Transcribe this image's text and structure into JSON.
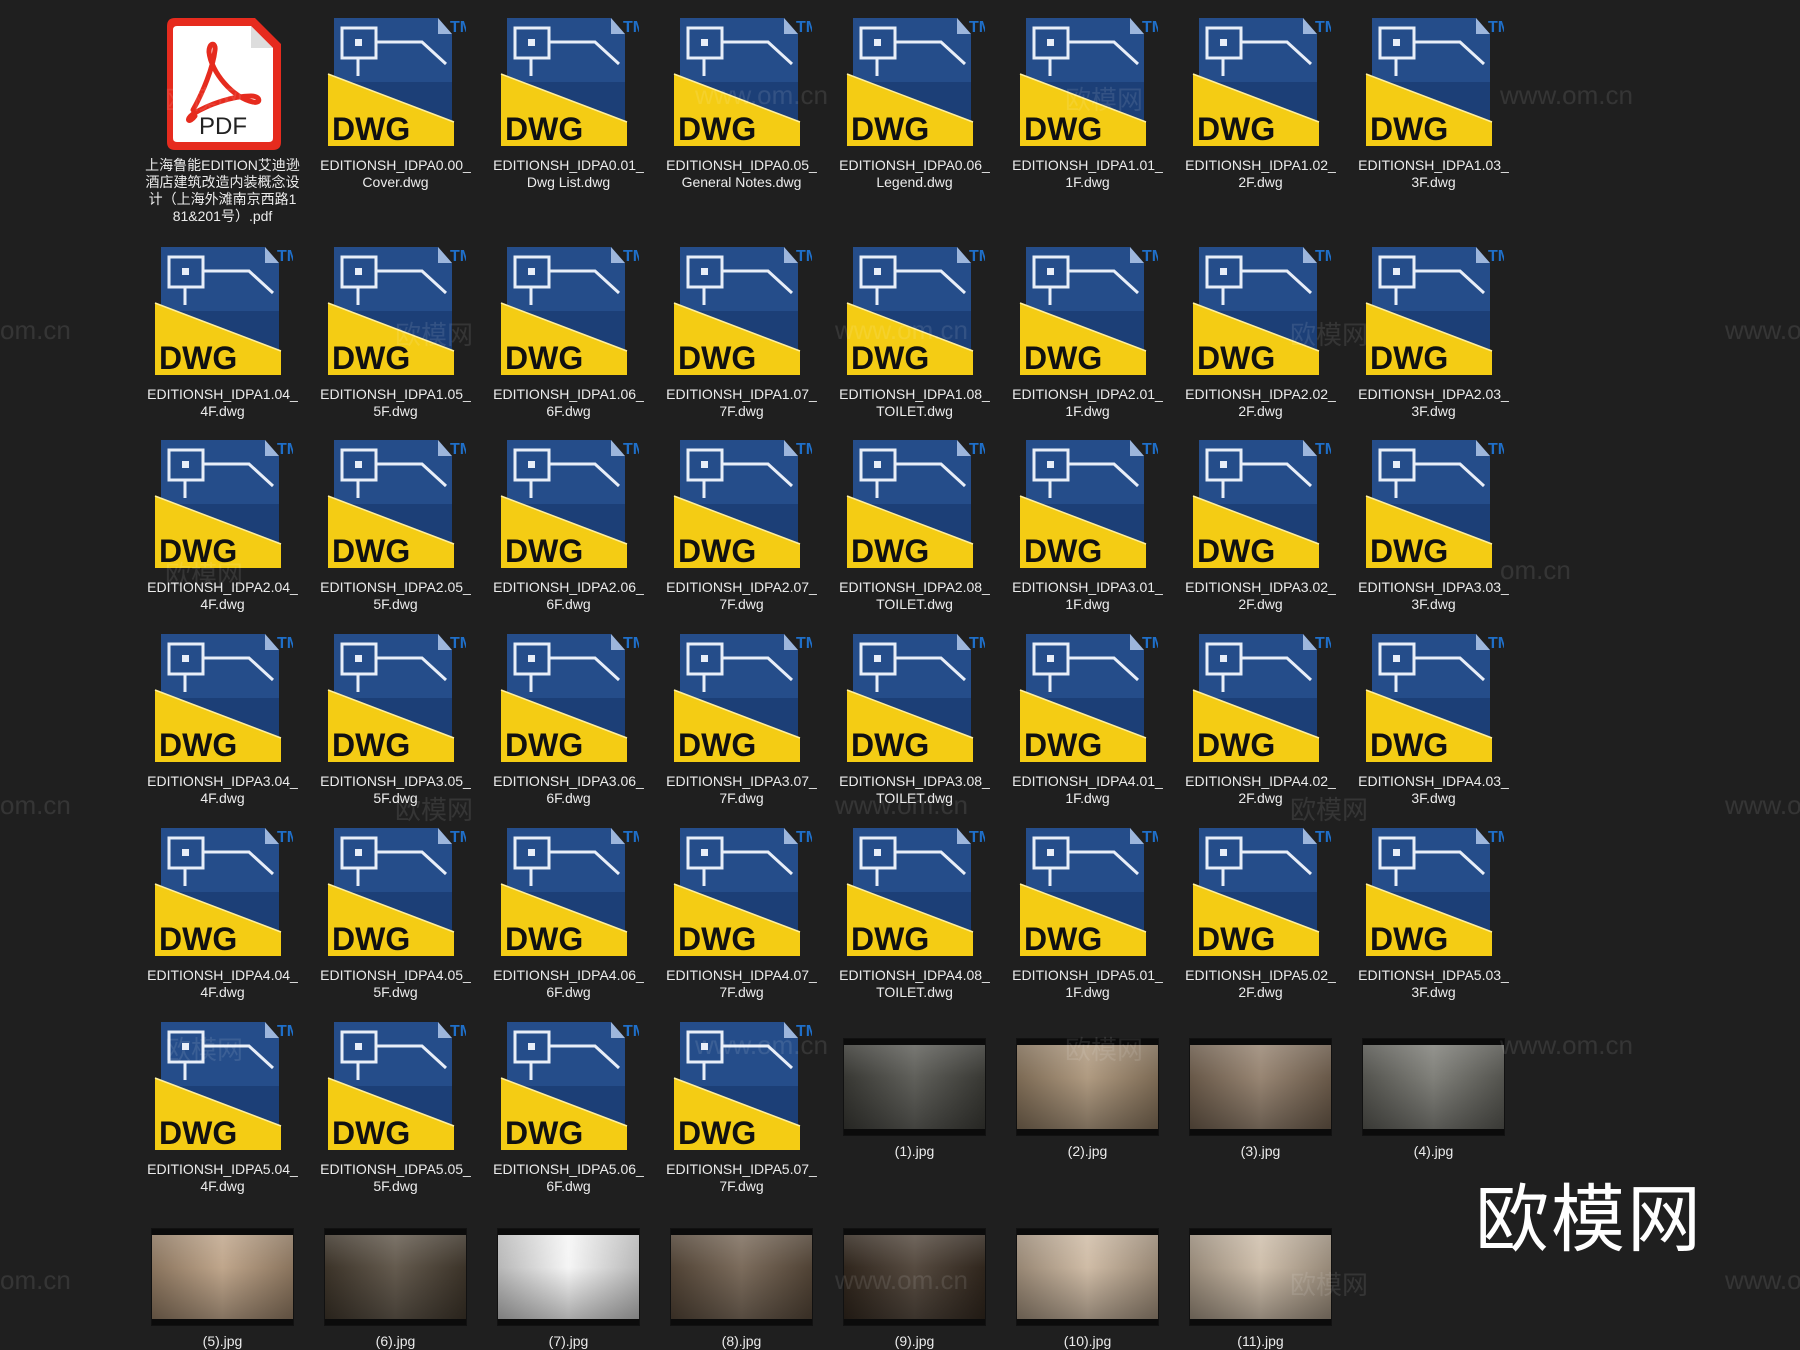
{
  "colors": {
    "background": "#1f1f1f",
    "dwg_yellow": "#f4cc14",
    "dwg_blue": "#1c3f77",
    "pdf_red": "#e62b1e",
    "tm_blue": "#1f6fc9",
    "label_text": "#ececec"
  },
  "watermarks": [
    "欧模网",
    "www.om.cn",
    "om.cn",
    "www.om.cn"
  ],
  "brand_watermark": "欧模网",
  "files": [
    {
      "type": "pdf",
      "icon": "pdf-file-icon",
      "badge": "PDF",
      "name": "上海鲁能EDITION艾迪逊酒店建筑改造内装概念设计（上海外滩南京西路181&201号）.pdf"
    },
    {
      "type": "dwg",
      "icon": "dwg-file-icon",
      "badge": "DWG",
      "tm": "TM",
      "name": "EDITIONSH_IDPA0.00_Cover.dwg"
    },
    {
      "type": "dwg",
      "icon": "dwg-file-icon",
      "badge": "DWG",
      "tm": "TM",
      "name": "EDITIONSH_IDPA0.01_Dwg List.dwg"
    },
    {
      "type": "dwg",
      "icon": "dwg-file-icon",
      "badge": "DWG",
      "tm": "TM",
      "name": "EDITIONSH_IDPA0.05_General Notes.dwg"
    },
    {
      "type": "dwg",
      "icon": "dwg-file-icon",
      "badge": "DWG",
      "tm": "TM",
      "name": "EDITIONSH_IDPA0.06_Legend.dwg"
    },
    {
      "type": "dwg",
      "icon": "dwg-file-icon",
      "badge": "DWG",
      "tm": "TM",
      "name": "EDITIONSH_IDPA1.01_1F.dwg"
    },
    {
      "type": "dwg",
      "icon": "dwg-file-icon",
      "badge": "DWG",
      "tm": "TM",
      "name": "EDITIONSH_IDPA1.02_2F.dwg"
    },
    {
      "type": "dwg",
      "icon": "dwg-file-icon",
      "badge": "DWG",
      "tm": "TM",
      "name": "EDITIONSH_IDPA1.03_3F.dwg"
    },
    {
      "type": "dwg",
      "icon": "dwg-file-icon",
      "badge": "DWG",
      "tm": "TM",
      "name": "EDITIONSH_IDPA1.04_4F.dwg"
    },
    {
      "type": "dwg",
      "icon": "dwg-file-icon",
      "badge": "DWG",
      "tm": "TM",
      "name": "EDITIONSH_IDPA1.05_5F.dwg"
    },
    {
      "type": "dwg",
      "icon": "dwg-file-icon",
      "badge": "DWG",
      "tm": "TM",
      "name": "EDITIONSH_IDPA1.06_6F.dwg"
    },
    {
      "type": "dwg",
      "icon": "dwg-file-icon",
      "badge": "DWG",
      "tm": "TM",
      "name": "EDITIONSH_IDPA1.07_7F.dwg"
    },
    {
      "type": "dwg",
      "icon": "dwg-file-icon",
      "badge": "DWG",
      "tm": "TM",
      "name": "EDITIONSH_IDPA1.08_TOILET.dwg"
    },
    {
      "type": "dwg",
      "icon": "dwg-file-icon",
      "badge": "DWG",
      "tm": "TM",
      "name": "EDITIONSH_IDPA2.01_1F.dwg"
    },
    {
      "type": "dwg",
      "icon": "dwg-file-icon",
      "badge": "DWG",
      "tm": "TM",
      "name": "EDITIONSH_IDPA2.02_2F.dwg"
    },
    {
      "type": "dwg",
      "icon": "dwg-file-icon",
      "badge": "DWG",
      "tm": "TM",
      "name": "EDITIONSH_IDPA2.03_3F.dwg"
    },
    {
      "type": "dwg",
      "icon": "dwg-file-icon",
      "badge": "DWG",
      "tm": "TM",
      "name": "EDITIONSH_IDPA2.04_4F.dwg"
    },
    {
      "type": "dwg",
      "icon": "dwg-file-icon",
      "badge": "DWG",
      "tm": "TM",
      "name": "EDITIONSH_IDPA2.05_5F.dwg"
    },
    {
      "type": "dwg",
      "icon": "dwg-file-icon",
      "badge": "DWG",
      "tm": "TM",
      "name": "EDITIONSH_IDPA2.06_6F.dwg"
    },
    {
      "type": "dwg",
      "icon": "dwg-file-icon",
      "badge": "DWG",
      "tm": "TM",
      "name": "EDITIONSH_IDPA2.07_7F.dwg"
    },
    {
      "type": "dwg",
      "icon": "dwg-file-icon",
      "badge": "DWG",
      "tm": "TM",
      "name": "EDITIONSH_IDPA2.08_TOILET.dwg"
    },
    {
      "type": "dwg",
      "icon": "dwg-file-icon",
      "badge": "DWG",
      "tm": "TM",
      "name": "EDITIONSH_IDPA3.01_1F.dwg"
    },
    {
      "type": "dwg",
      "icon": "dwg-file-icon",
      "badge": "DWG",
      "tm": "TM",
      "name": "EDITIONSH_IDPA3.02_2F.dwg"
    },
    {
      "type": "dwg",
      "icon": "dwg-file-icon",
      "badge": "DWG",
      "tm": "TM",
      "name": "EDITIONSH_IDPA3.03_3F.dwg"
    },
    {
      "type": "dwg",
      "icon": "dwg-file-icon",
      "badge": "DWG",
      "tm": "TM",
      "name": "EDITIONSH_IDPA3.04_4F.dwg"
    },
    {
      "type": "dwg",
      "icon": "dwg-file-icon",
      "badge": "DWG",
      "tm": "TM",
      "name": "EDITIONSH_IDPA3.05_5F.dwg"
    },
    {
      "type": "dwg",
      "icon": "dwg-file-icon",
      "badge": "DWG",
      "tm": "TM",
      "name": "EDITIONSH_IDPA3.06_6F.dwg"
    },
    {
      "type": "dwg",
      "icon": "dwg-file-icon",
      "badge": "DWG",
      "tm": "TM",
      "name": "EDITIONSH_IDPA3.07_7F.dwg"
    },
    {
      "type": "dwg",
      "icon": "dwg-file-icon",
      "badge": "DWG",
      "tm": "TM",
      "name": "EDITIONSH_IDPA3.08_TOILET.dwg"
    },
    {
      "type": "dwg",
      "icon": "dwg-file-icon",
      "badge": "DWG",
      "tm": "TM",
      "name": "EDITIONSH_IDPA4.01_1F.dwg"
    },
    {
      "type": "dwg",
      "icon": "dwg-file-icon",
      "badge": "DWG",
      "tm": "TM",
      "name": "EDITIONSH_IDPA4.02_2F.dwg"
    },
    {
      "type": "dwg",
      "icon": "dwg-file-icon",
      "badge": "DWG",
      "tm": "TM",
      "name": "EDITIONSH_IDPA4.03_3F.dwg"
    },
    {
      "type": "dwg",
      "icon": "dwg-file-icon",
      "badge": "DWG",
      "tm": "TM",
      "name": "EDITIONSH_IDPA4.04_4F.dwg"
    },
    {
      "type": "dwg",
      "icon": "dwg-file-icon",
      "badge": "DWG",
      "tm": "TM",
      "name": "EDITIONSH_IDPA4.05_5F.dwg"
    },
    {
      "type": "dwg",
      "icon": "dwg-file-icon",
      "badge": "DWG",
      "tm": "TM",
      "name": "EDITIONSH_IDPA4.06_6F.dwg"
    },
    {
      "type": "dwg",
      "icon": "dwg-file-icon",
      "badge": "DWG",
      "tm": "TM",
      "name": "EDITIONSH_IDPA4.07_7F.dwg"
    },
    {
      "type": "dwg",
      "icon": "dwg-file-icon",
      "badge": "DWG",
      "tm": "TM",
      "name": "EDITIONSH_IDPA4.08_TOILET.dwg"
    },
    {
      "type": "dwg",
      "icon": "dwg-file-icon",
      "badge": "DWG",
      "tm": "TM",
      "name": "EDITIONSH_IDPA5.01_1F.dwg"
    },
    {
      "type": "dwg",
      "icon": "dwg-file-icon",
      "badge": "DWG",
      "tm": "TM",
      "name": "EDITIONSH_IDPA5.02_2F.dwg"
    },
    {
      "type": "dwg",
      "icon": "dwg-file-icon",
      "badge": "DWG",
      "tm": "TM",
      "name": "EDITIONSH_IDPA5.03_3F.dwg"
    },
    {
      "type": "dwg",
      "icon": "dwg-file-icon",
      "badge": "DWG",
      "tm": "TM",
      "name": "EDITIONSH_IDPA5.04_4F.dwg"
    },
    {
      "type": "dwg",
      "icon": "dwg-file-icon",
      "badge": "DWG",
      "tm": "TM",
      "name": "EDITIONSH_IDPA5.05_5F.dwg"
    },
    {
      "type": "dwg",
      "icon": "dwg-file-icon",
      "badge": "DWG",
      "tm": "TM",
      "name": "EDITIONSH_IDPA5.06_6F.dwg"
    },
    {
      "type": "dwg",
      "icon": "dwg-file-icon",
      "badge": "DWG",
      "tm": "TM",
      "name": "EDITIONSH_IDPA5.07_7F.dwg"
    },
    {
      "type": "jpg",
      "icon": "image-thumbnail",
      "name": "(1).jpg",
      "tone": "#4a4a44"
    },
    {
      "type": "jpg",
      "icon": "image-thumbnail",
      "name": "(2).jpg",
      "tone": "#a58d70"
    },
    {
      "type": "jpg",
      "icon": "image-thumbnail",
      "name": "(3).jpg",
      "tone": "#8a7560"
    },
    {
      "type": "jpg",
      "icon": "image-thumbnail",
      "name": "(4).jpg",
      "tone": "#6f6f68"
    },
    {
      "type": "jpg",
      "icon": "image-thumbnail",
      "name": "(5).jpg",
      "tone": "#b79a7c"
    },
    {
      "type": "jpg",
      "icon": "image-thumbnail",
      "name": "(6).jpg",
      "tone": "#4f4436"
    },
    {
      "type": "jpg",
      "icon": "image-thumbnail",
      "name": "(7).jpg",
      "tone": "#f4f4f4"
    },
    {
      "type": "jpg",
      "icon": "image-thumbnail",
      "name": "(8).jpg",
      "tone": "#6a5846"
    },
    {
      "type": "jpg",
      "icon": "image-thumbnail",
      "name": "(9).jpg",
      "tone": "#3f3226"
    },
    {
      "type": "jpg",
      "icon": "image-thumbnail",
      "name": "(10).jpg",
      "tone": "#c9b39a"
    },
    {
      "type": "jpg",
      "icon": "image-thumbnail",
      "name": "(11).jpg",
      "tone": "#c8b6a0"
    }
  ]
}
